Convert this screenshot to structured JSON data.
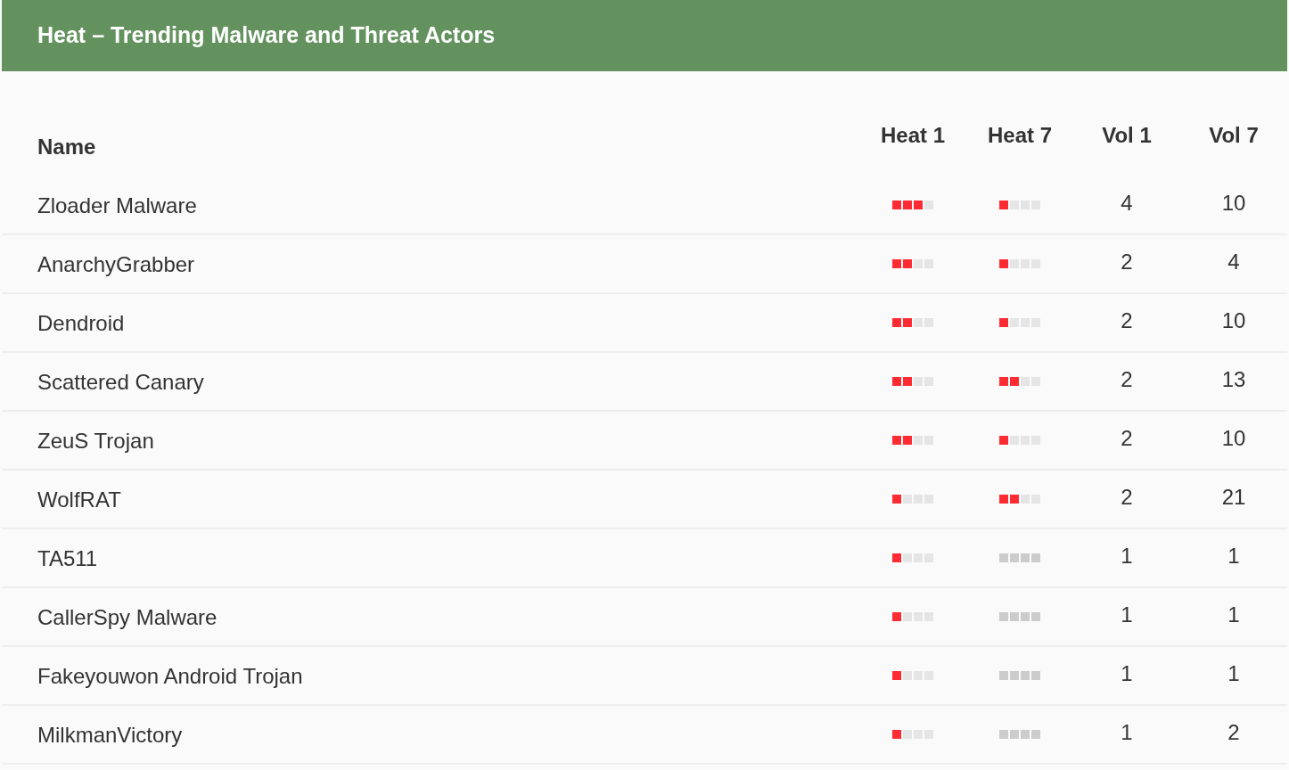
{
  "header": {
    "title": "Heat – Trending Malware and Threat Actors"
  },
  "table": {
    "columns": [
      "Name",
      "Heat 1",
      "Heat 7",
      "Vol 1",
      "Vol 7"
    ],
    "rows": [
      {
        "name": "Zloader Malware",
        "heat_1": {
          "stars": 3
        },
        "heat_7": {
          "stars": 1
        },
        "vol_1": "4",
        "vol_7": "10"
      },
      {
        "name": "AnarchyGrabber",
        "heat_1": {
          "stars": 2
        },
        "heat_7": {
          "stars": 1
        },
        "vol_1": "2",
        "vol_7": "4"
      },
      {
        "name": "Dendroid",
        "heat_1": {
          "stars": 2
        },
        "heat_7": {
          "stars": 1
        },
        "vol_1": "2",
        "vol_7": "10"
      },
      {
        "name": "Scattered Canary",
        "heat_1": {
          "stars": 2
        },
        "heat_7": {
          "stars": 2
        },
        "vol_1": "2",
        "vol_7": "13"
      },
      {
        "name": "ZeuS Trojan",
        "heat_1": {
          "stars": 2
        },
        "heat_7": {
          "stars": 1
        },
        "vol_1": "2",
        "vol_7": "10"
      },
      {
        "name": "WolfRAT",
        "heat_1": {
          "stars": 1
        },
        "heat_7": {
          "stars": 2
        },
        "vol_1": "2",
        "vol_7": "21"
      },
      {
        "name": "TA511",
        "heat_1": {
          "stars": 1
        },
        "heat_7": {
          "stars": 0
        },
        "vol_1": "1",
        "vol_7": "1"
      },
      {
        "name": "CallerSpy Malware",
        "heat_1": {
          "stars": 1
        },
        "heat_7": {
          "stars": 0
        },
        "vol_1": "1",
        "vol_7": "1"
      },
      {
        "name": "Fakeyouwon Android Trojan",
        "heat_1": {
          "stars": 1
        },
        "heat_7": {
          "stars": 0
        },
        "vol_1": "1",
        "vol_7": "1"
      },
      {
        "name": "MilkmanVictory",
        "heat_1": {
          "stars": 1
        },
        "heat_7": {
          "stars": 0
        },
        "vol_1": "1",
        "vol_7": "2"
      }
    ]
  }
}
